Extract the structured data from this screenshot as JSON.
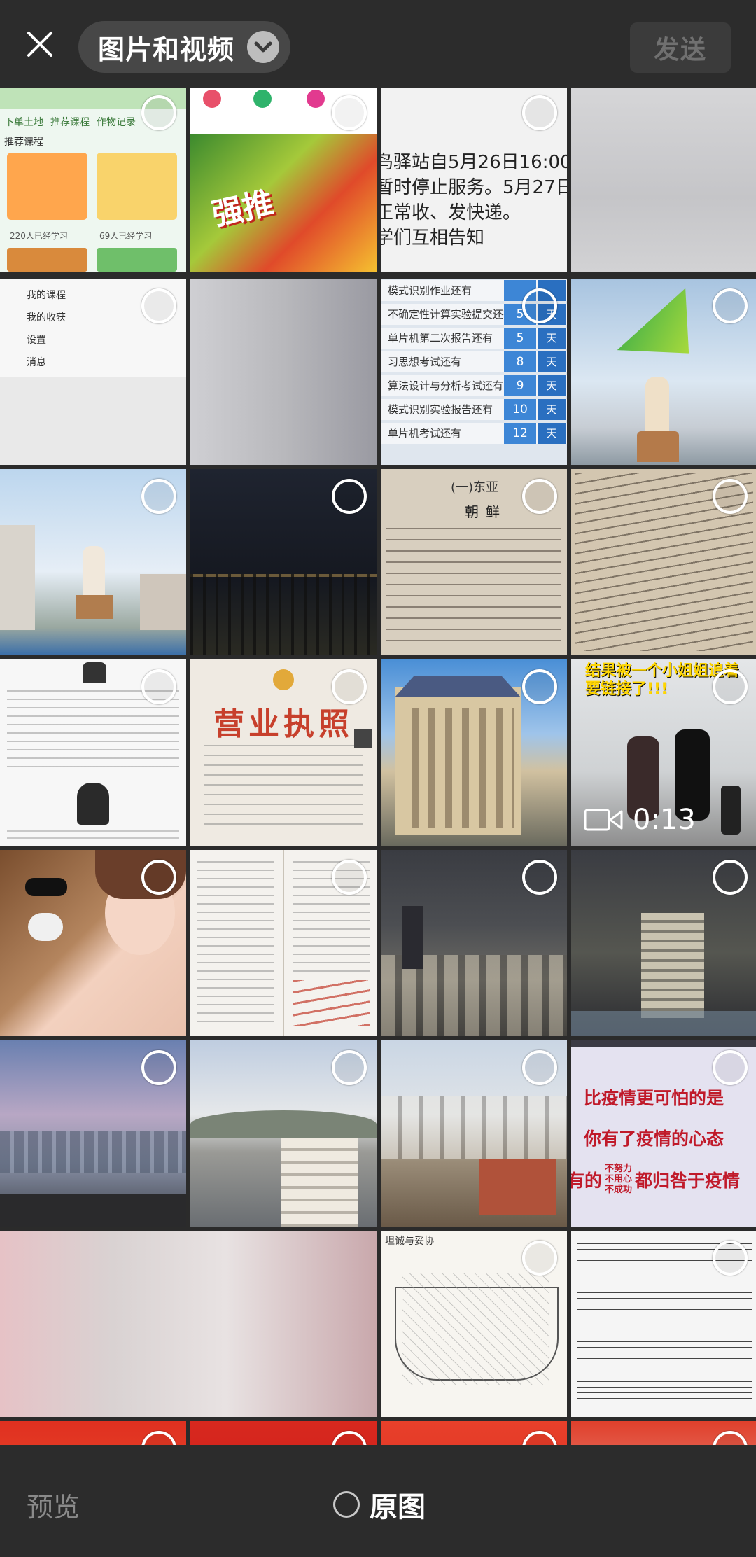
{
  "header": {
    "album_title": "图片和视频",
    "send_label": "发送"
  },
  "bottom": {
    "preview_label": "预览",
    "original_label": "原图"
  },
  "tiles": {
    "t1": {
      "tabs": [
        "下单土地",
        "推荐课程",
        "作物记录"
      ],
      "section": "推荐课程",
      "learners_a": "220人已经学习",
      "learners_b": "69人已经学习"
    },
    "t2": {
      "banner": "强推",
      "menu": [
        "我的课程",
        "我的收获",
        "设置",
        "消息"
      ]
    },
    "t3": {
      "lines": [
        "鸟驿站自5月26日16:00",
        "暂时停止服务。5月27日",
        "正常收、发快递。",
        "学们互相告知"
      ]
    },
    "t7": {
      "rows": [
        {
          "label": "模式识别作业还有",
          "num": "",
          "unit": ""
        },
        {
          "label": "不确定性计算实验提交还有",
          "num": "5",
          "unit": "天"
        },
        {
          "label": "单片机第二次报告还有",
          "num": "5",
          "unit": "天"
        },
        {
          "label": "习思想考试还有",
          "num": "8",
          "unit": "天"
        },
        {
          "label": "算法设计与分析考试还有",
          "num": "9",
          "unit": "天"
        },
        {
          "label": "模式识别实验报告还有",
          "num": "10",
          "unit": "天"
        },
        {
          "label": "单片机考试还有",
          "num": "12",
          "unit": "天"
        }
      ]
    },
    "t11": {
      "heading": "朝鲜",
      "subheading": "(一)东亚"
    },
    "t14": {
      "title": "营业执照"
    },
    "t16": {
      "caption": "结果被一个小姐姐追着要链接了!!!",
      "duration": "0:13"
    },
    "t24": {
      "line1": "比疫情更可怕的是",
      "line2": "你有了疫情的心态",
      "line3_left": "有的",
      "line3_small": [
        "不努力",
        "不用心",
        "不成功"
      ],
      "line3_right": "都归咎于疫情"
    },
    "t27": {
      "title": "坦诚与妥协"
    }
  },
  "colors": {
    "background": "#2b2b2b",
    "header": "#2c2c2c",
    "pill": "#474747",
    "send_disabled_text": "#707070"
  },
  "icons": {
    "close": "close-icon",
    "album_chevron": "chevron-down-icon",
    "video": "video-camera-icon",
    "radio": "radio-unchecked-icon"
  }
}
